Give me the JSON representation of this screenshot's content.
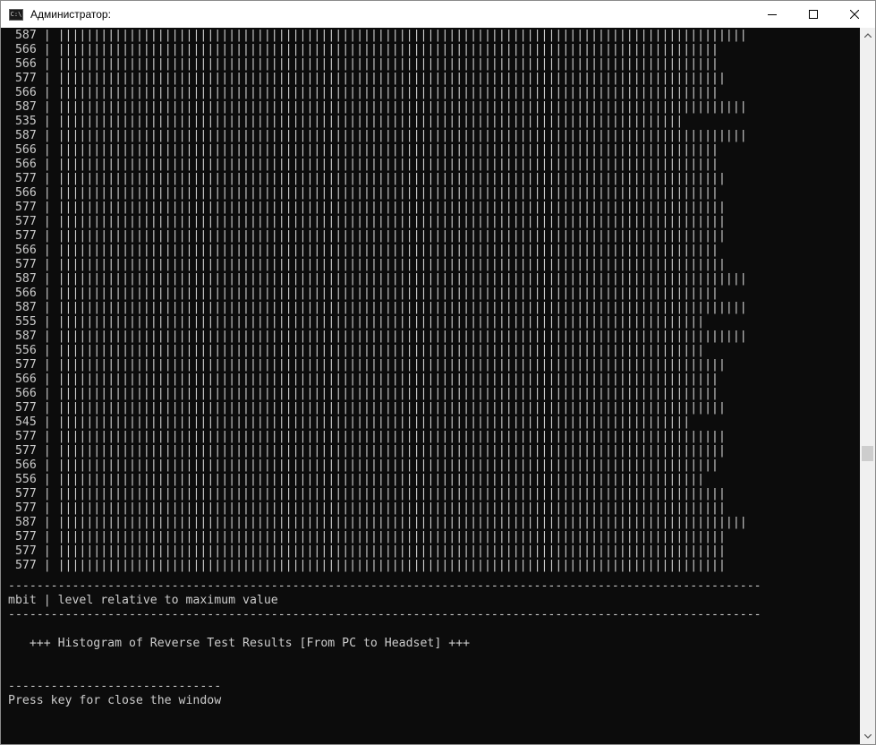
{
  "window": {
    "title": "Администратор:",
    "icon_glyph": "C:\\",
    "icon_name": "cmd-app-icon",
    "controls": [
      "minimize-icon",
      "maximize-icon",
      "close-icon"
    ]
  },
  "console": {
    "histogram": [
      {
        "value": "587",
        "bar": "| |||||||||||||||||||||||||||||||||||||||||||||||||||||||||||||||||||||||||||||||||||||||||||||||||"
      },
      {
        "value": "566",
        "bar": "| |||||||||||||||||||||||||||||||||||||||||||||||||||||||||||||||||||||||||||||||||||||||||||||"
      },
      {
        "value": "566",
        "bar": "| |||||||||||||||||||||||||||||||||||||||||||||||||||||||||||||||||||||||||||||||||||||||||||||"
      },
      {
        "value": "577",
        "bar": "| ||||||||||||||||||||||||||||||||||||||||||||||||||||||||||||||||||||||||||||||||||||||||||||||"
      },
      {
        "value": "566",
        "bar": "| |||||||||||||||||||||||||||||||||||||||||||||||||||||||||||||||||||||||||||||||||||||||||||||"
      },
      {
        "value": "587",
        "bar": "| |||||||||||||||||||||||||||||||||||||||||||||||||||||||||||||||||||||||||||||||||||||||||||||||||"
      },
      {
        "value": "535",
        "bar": "| ||||||||||||||||||||||||||||||||||||||||||||||||||||||||||||||||||||||||||||||||||||||||"
      },
      {
        "value": "587",
        "bar": "| |||||||||||||||||||||||||||||||||||||||||||||||||||||||||||||||||||||||||||||||||||||||||||||||||"
      },
      {
        "value": "566",
        "bar": "| |||||||||||||||||||||||||||||||||||||||||||||||||||||||||||||||||||||||||||||||||||||||||||||"
      },
      {
        "value": "566",
        "bar": "| |||||||||||||||||||||||||||||||||||||||||||||||||||||||||||||||||||||||||||||||||||||||||||||"
      },
      {
        "value": "577",
        "bar": "| ||||||||||||||||||||||||||||||||||||||||||||||||||||||||||||||||||||||||||||||||||||||||||||||"
      },
      {
        "value": "566",
        "bar": "| |||||||||||||||||||||||||||||||||||||||||||||||||||||||||||||||||||||||||||||||||||||||||||||"
      },
      {
        "value": "577",
        "bar": "| ||||||||||||||||||||||||||||||||||||||||||||||||||||||||||||||||||||||||||||||||||||||||||||||"
      },
      {
        "value": "577",
        "bar": "| ||||||||||||||||||||||||||||||||||||||||||||||||||||||||||||||||||||||||||||||||||||||||||||||"
      },
      {
        "value": "577",
        "bar": "| ||||||||||||||||||||||||||||||||||||||||||||||||||||||||||||||||||||||||||||||||||||||||||||||"
      },
      {
        "value": "566",
        "bar": "| |||||||||||||||||||||||||||||||||||||||||||||||||||||||||||||||||||||||||||||||||||||||||||||"
      },
      {
        "value": "577",
        "bar": "| ||||||||||||||||||||||||||||||||||||||||||||||||||||||||||||||||||||||||||||||||||||||||||||||"
      },
      {
        "value": "587",
        "bar": "| |||||||||||||||||||||||||||||||||||||||||||||||||||||||||||||||||||||||||||||||||||||||||||||||||"
      },
      {
        "value": "566",
        "bar": "| |||||||||||||||||||||||||||||||||||||||||||||||||||||||||||||||||||||||||||||||||||||||||||||"
      },
      {
        "value": "587",
        "bar": "| |||||||||||||||||||||||||||||||||||||||||||||||||||||||||||||||||||||||||||||||||||||||||||||||||"
      },
      {
        "value": "555",
        "bar": "| |||||||||||||||||||||||||||||||||||||||||||||||||||||||||||||||||||||||||||||||||||||||||||"
      },
      {
        "value": "587",
        "bar": "| |||||||||||||||||||||||||||||||||||||||||||||||||||||||||||||||||||||||||||||||||||||||||||||||||"
      },
      {
        "value": "556",
        "bar": "| |||||||||||||||||||||||||||||||||||||||||||||||||||||||||||||||||||||||||||||||||||||||||||"
      },
      {
        "value": "577",
        "bar": "| ||||||||||||||||||||||||||||||||||||||||||||||||||||||||||||||||||||||||||||||||||||||||||||||"
      },
      {
        "value": "566",
        "bar": "| |||||||||||||||||||||||||||||||||||||||||||||||||||||||||||||||||||||||||||||||||||||||||||||"
      },
      {
        "value": "566",
        "bar": "| |||||||||||||||||||||||||||||||||||||||||||||||||||||||||||||||||||||||||||||||||||||||||||||"
      },
      {
        "value": "577",
        "bar": "| ||||||||||||||||||||||||||||||||||||||||||||||||||||||||||||||||||||||||||||||||||||||||||||||"
      },
      {
        "value": "545",
        "bar": "| |||||||||||||||||||||||||||||||||||||||||||||||||||||||||||||||||||||||||||||||||||||||||"
      },
      {
        "value": "577",
        "bar": "| ||||||||||||||||||||||||||||||||||||||||||||||||||||||||||||||||||||||||||||||||||||||||||||||"
      },
      {
        "value": "577",
        "bar": "| ||||||||||||||||||||||||||||||||||||||||||||||||||||||||||||||||||||||||||||||||||||||||||||||"
      },
      {
        "value": "566",
        "bar": "| |||||||||||||||||||||||||||||||||||||||||||||||||||||||||||||||||||||||||||||||||||||||||||||"
      },
      {
        "value": "556",
        "bar": "| |||||||||||||||||||||||||||||||||||||||||||||||||||||||||||||||||||||||||||||||||||||||||||"
      },
      {
        "value": "577",
        "bar": "| ||||||||||||||||||||||||||||||||||||||||||||||||||||||||||||||||||||||||||||||||||||||||||||||"
      },
      {
        "value": "577",
        "bar": "| ||||||||||||||||||||||||||||||||||||||||||||||||||||||||||||||||||||||||||||||||||||||||||||||"
      },
      {
        "value": "587",
        "bar": "| |||||||||||||||||||||||||||||||||||||||||||||||||||||||||||||||||||||||||||||||||||||||||||||||||"
      },
      {
        "value": "577",
        "bar": "| ||||||||||||||||||||||||||||||||||||||||||||||||||||||||||||||||||||||||||||||||||||||||||||||"
      },
      {
        "value": "577",
        "bar": "| ||||||||||||||||||||||||||||||||||||||||||||||||||||||||||||||||||||||||||||||||||||||||||||||"
      },
      {
        "value": "577",
        "bar": "| ||||||||||||||||||||||||||||||||||||||||||||||||||||||||||||||||||||||||||||||||||||||||||||||"
      }
    ],
    "separator_top": "----------------------------------------------------------------------------------------------------------",
    "legend_line": "mbit | level relative to maximum value",
    "separator_bottom": "----------------------------------------------------------------------------------------------------------",
    "histogram_title": "   +++ Histogram of Reverse Test Results [From PC to Headset] +++",
    "short_separator": "------------------------------",
    "prompt_line": "Press key for close the window"
  }
}
